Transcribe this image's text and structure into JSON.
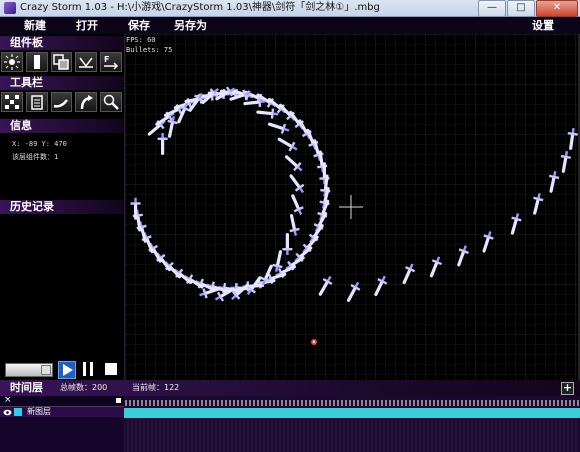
{
  "window": {
    "title": "Crazy Storm 1.03 - H:\\小游戏\\CrazyStorm 1.03\\神器\\剑符「剑之林①」.mbg",
    "min": "—",
    "max": "□",
    "close": "✕"
  },
  "menu": {
    "new": "新建",
    "open": "打开",
    "save": "保存",
    "save_as": "另存为",
    "settings": "设置"
  },
  "sidebar": {
    "components_header": "组件板",
    "tools_header": "工具栏",
    "info_header": "信息",
    "history_header": "历史记录",
    "info": {
      "coords": "X: -89  Y: 470",
      "layer_count": "该层组件数：1"
    },
    "component_icons": [
      "emitter-icon",
      "laser-icon",
      "copy-layer-icon",
      "reflector-icon",
      "force-field-icon"
    ],
    "tool_icons": [
      "grid-align-icon",
      "clipboard-icon",
      "curve-tool-icon",
      "rotate-tool-icon",
      "zoom-icon"
    ]
  },
  "canvas": {
    "fps": "FPS: 60",
    "bullets": "Bullets: 75"
  },
  "timeline": {
    "header": "时间层",
    "total_frames": "总帧数：200",
    "current_frame": "当前帧：122",
    "add": "+",
    "close": "×"
  },
  "layer": {
    "name": "新图层",
    "color": "#35c8f0"
  },
  "colors": {
    "accent": "#3a1458",
    "panel": "#15052a",
    "bullet": "#e6e6ff",
    "timeline_bar": "#38d0d8"
  }
}
